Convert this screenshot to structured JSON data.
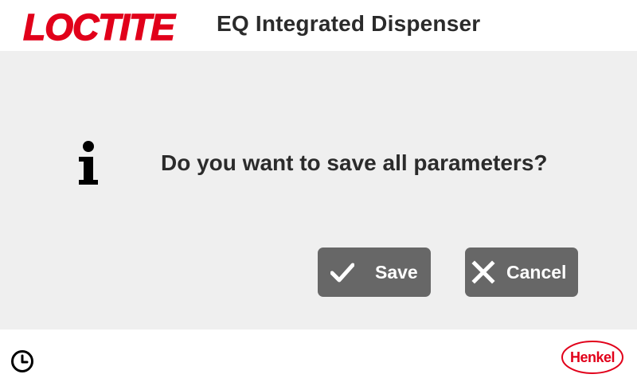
{
  "header": {
    "brand_logo": "LOCTITE",
    "title": "EQ Integrated Dispenser"
  },
  "dialog": {
    "icon": "info-icon",
    "message": "Do you want to save all parameters?",
    "buttons": {
      "save_label": "Save",
      "save_icon": "checkmark-icon",
      "cancel_label": "Cancel",
      "cancel_icon": "close-icon"
    }
  },
  "footer": {
    "clock_icon": "clock-icon",
    "company_logo": "Henkel"
  },
  "colors": {
    "brand_red": "#e1001a",
    "button_gray": "#676767",
    "dialog_background": "#efefef",
    "text_dark": "#2b2b2b"
  }
}
